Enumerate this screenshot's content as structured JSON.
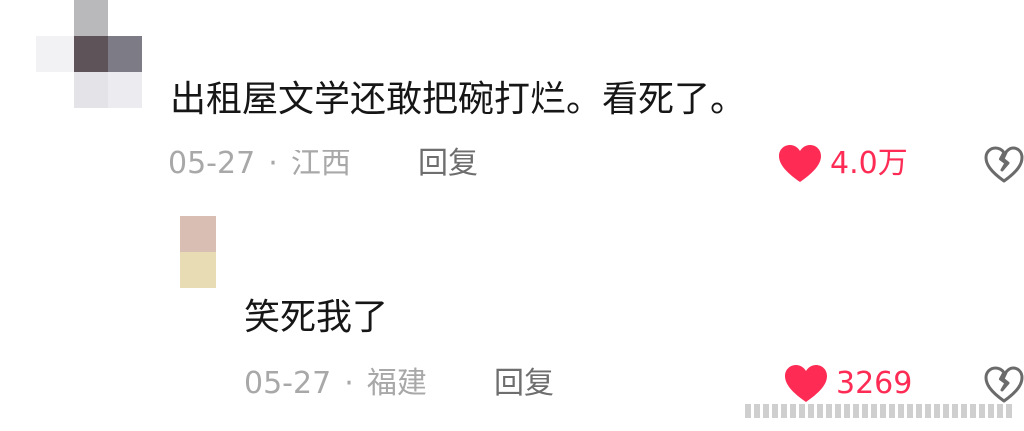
{
  "comments": [
    {
      "text": "出租屋文学还敢把碗打烂。看死了。",
      "date": "05-27",
      "separator": "·",
      "location": "江西",
      "reply_label": "回复",
      "likes": "4.0万",
      "like_icon": "heart-icon",
      "dislike_icon": "broken-heart-icon"
    }
  ],
  "replies": [
    {
      "text": "笑死我了",
      "date": "05-27",
      "separator": "·",
      "location": "福建",
      "reply_label": "回复",
      "likes": "3269",
      "like_icon": "heart-icon",
      "dislike_icon": "broken-heart-icon"
    }
  ],
  "colors": {
    "accent": "#fe2c55",
    "meta_text": "#a8a8a8",
    "reply_text": "#6e6e6e"
  }
}
